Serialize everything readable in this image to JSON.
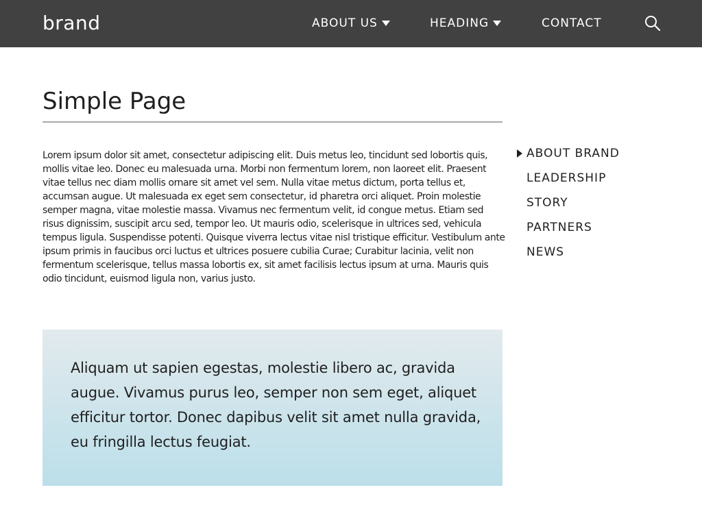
{
  "header": {
    "brand": "brand",
    "nav": {
      "about_us": "ABOUT US",
      "heading": "HEADING",
      "contact": "CONTACT"
    },
    "search_icon": "search-icon"
  },
  "main": {
    "title": "Simple Page",
    "body": "Lorem ipsum dolor sit amet, consectetur adipiscing elit. Duis metus leo, tincidunt sed lobortis quis, mollis vitae leo. Donec eu malesuada urna. Morbi non fermentum lorem, non laoreet elit. Praesent vitae tellus nec diam mollis ornare sit amet vel sem. Nulla vitae metus dictum, porta tellus et, accumsan augue. Ut malesuada ex eget sem consectetur, id pharetra orci aliquet. Proin molestie semper magna, vitae molestie massa. Vivamus nec fermentum velit, id congue metus. Etiam sed risus dignissim, suscipit arcu sed, tempor leo. Ut mauris odio, scelerisque in ultrices sed, vehicula tempus ligula. Suspendisse potenti. Quisque viverra lectus vitae nisl tristique efficitur. Vestibulum ante ipsum primis in faucibus orci luctus et ultrices posuere cubilia Curae; Curabitur lacinia, velit non fermentum scelerisque, tellus massa lobortis ex, sit amet facilisis lectus ipsum at urna. Mauris quis odio tincidunt, euismod ligula non, varius justo.",
    "callout": "Aliquam ut sapien egestas, molestie libero ac, gravida augue. Vivamus purus leo, semper non sem eget, aliquet efficitur tortor. Donec dapibus velit sit amet nulla gravida, eu fringilla lectus feugiat."
  },
  "sidebar": {
    "items": [
      {
        "label": "ABOUT BRAND",
        "active": true
      },
      {
        "label": "LEADERSHIP",
        "active": false
      },
      {
        "label": "STORY",
        "active": false
      },
      {
        "label": "PARTNERS",
        "active": false
      },
      {
        "label": "NEWS",
        "active": false
      }
    ]
  },
  "colors": {
    "header_bg": "#414141",
    "text": "#1f1f1f",
    "rule": "#a9a9a9",
    "callout_top": "#e2eaed",
    "callout_bottom": "#bbdfea"
  }
}
